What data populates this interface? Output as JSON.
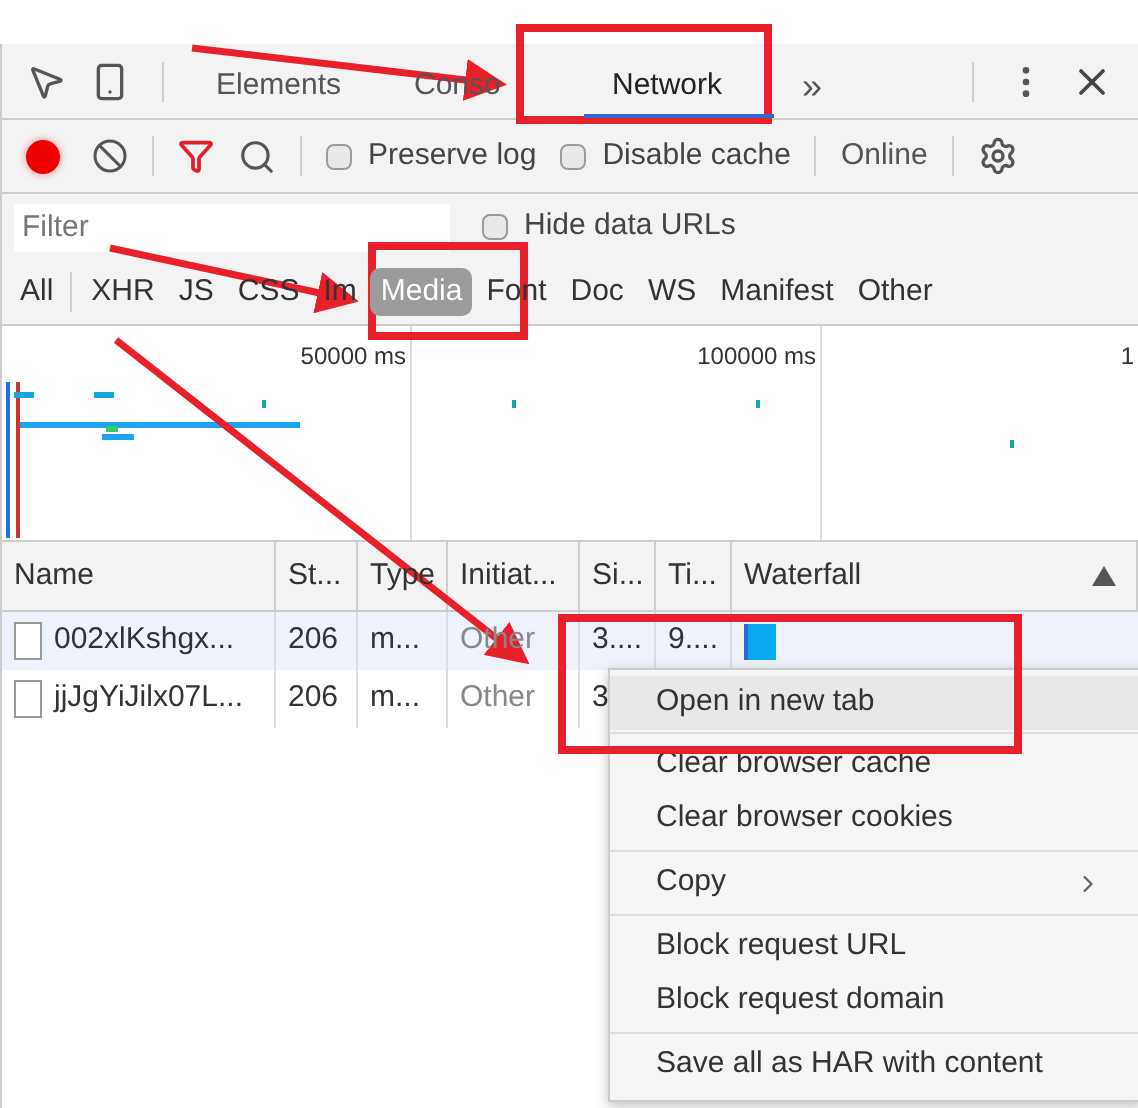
{
  "tabs": [
    {
      "label": "Elements",
      "selected": false
    },
    {
      "label": "Conso",
      "selected": false
    },
    {
      "label": "Network",
      "selected": true
    }
  ],
  "more_tabs": "»",
  "toolbar": {
    "recording": true,
    "filter_active": true,
    "preserve_log": {
      "label": "Preserve log",
      "checked": false
    },
    "disable_cache": {
      "label": "Disable cache",
      "checked": false
    },
    "throttling": "Online"
  },
  "filter": {
    "placeholder": "Filter",
    "hide_data_urls": {
      "label": "Hide data URLs",
      "checked": false
    }
  },
  "types": [
    {
      "label": "All",
      "selected": false
    },
    {
      "label": "XHR",
      "selected": false
    },
    {
      "label": "JS",
      "selected": false
    },
    {
      "label": "CSS",
      "selected": false
    },
    {
      "label": "Im",
      "selected": false
    },
    {
      "label": "Media",
      "selected": true
    },
    {
      "label": "Font",
      "selected": false
    },
    {
      "label": "Doc",
      "selected": false
    },
    {
      "label": "WS",
      "selected": false
    },
    {
      "label": "Manifest",
      "selected": false
    },
    {
      "label": "Other",
      "selected": false
    }
  ],
  "timeline": {
    "ticks": [
      "50000 ms",
      "100000 ms",
      "1"
    ]
  },
  "table": {
    "columns": [
      "Name",
      "St...",
      "Type",
      "Initiat...",
      "Si...",
      "Ti...",
      "Waterfall"
    ],
    "rows": [
      {
        "selected": true,
        "cells": [
          "002xlKshgx...",
          "206",
          "m...",
          "Other",
          "3....",
          "9...."
        ],
        "waterfall_bar": true
      },
      {
        "selected": false,
        "cells": [
          "jjJgYiJilx07L...",
          "206",
          "m...",
          "Other",
          "3"
        ]
      }
    ]
  },
  "context_menu": {
    "groups": [
      [
        {
          "label": "Open in new tab",
          "highlighted": true,
          "kind": "item"
        }
      ],
      [
        {
          "label": "Clear browser cache",
          "highlighted": false,
          "kind": "item"
        },
        {
          "label": "Clear browser cookies",
          "highlighted": false,
          "kind": "item"
        }
      ],
      [
        {
          "label": "Copy",
          "highlighted": false,
          "kind": "submenu"
        }
      ],
      [
        {
          "label": "Block request URL",
          "highlighted": false,
          "kind": "item"
        },
        {
          "label": "Block request domain",
          "highlighted": false,
          "kind": "item"
        }
      ],
      [
        {
          "label": "Save all as HAR with content",
          "highlighted": false,
          "kind": "item"
        }
      ]
    ]
  }
}
